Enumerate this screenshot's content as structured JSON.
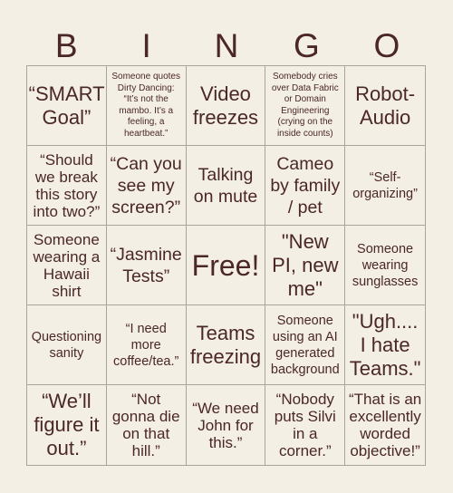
{
  "header": {
    "letters": [
      "B",
      "I",
      "N",
      "G",
      "O"
    ]
  },
  "cells": [
    {
      "text": "“SMART Goal”",
      "size": "xl"
    },
    {
      "text": "Someone quotes Dirty Dancing: “It’s not the mambo. It’s a feeling, a heartbeat.”",
      "size": "xs"
    },
    {
      "text": "Video freezes",
      "size": "xl"
    },
    {
      "text": "Somebody cries over Data Fabric or Domain Engineering (crying on the inside counts)",
      "size": "xs"
    },
    {
      "text": "Robot-Audio",
      "size": "xl"
    },
    {
      "text": "“Should we break this story into two?”",
      "size": "m"
    },
    {
      "text": "“Can you see my screen?”",
      "size": "l"
    },
    {
      "text": "Talking on mute",
      "size": "l"
    },
    {
      "text": "Cameo by family / pet",
      "size": "l"
    },
    {
      "text": "“Self-organizing”",
      "size": "s"
    },
    {
      "text": "Someone wearing a Hawaii shirt",
      "size": "m"
    },
    {
      "text": "“Jasmine Tests”",
      "size": "l"
    },
    {
      "text": "Free!",
      "size": "free"
    },
    {
      "text": "\"New PI, new me\"",
      "size": "xl"
    },
    {
      "text": "Someone wearing sunglasses",
      "size": "s"
    },
    {
      "text": "Questioning sanity",
      "size": "s"
    },
    {
      "text": "“I need more coffee/tea.”",
      "size": "s"
    },
    {
      "text": "Teams freezing",
      "size": "xl"
    },
    {
      "text": "Someone using an AI generated background",
      "size": "s"
    },
    {
      "text": "\"Ugh.... I hate Teams.\"",
      "size": "xl"
    },
    {
      "text": "“We’ll figure it out.”",
      "size": "xl"
    },
    {
      "text": "“Not gonna die on that hill.”",
      "size": "m"
    },
    {
      "text": "“We need John for this.”",
      "size": "m"
    },
    {
      "text": "“Nobody puts Silvi in a corner.”",
      "size": "m"
    },
    {
      "text": "“That is an excellently worded objective!”",
      "size": "m"
    }
  ],
  "colors": {
    "background": "#f3efe4",
    "text": "#4b2727",
    "grid_line": "#a9a59c"
  }
}
